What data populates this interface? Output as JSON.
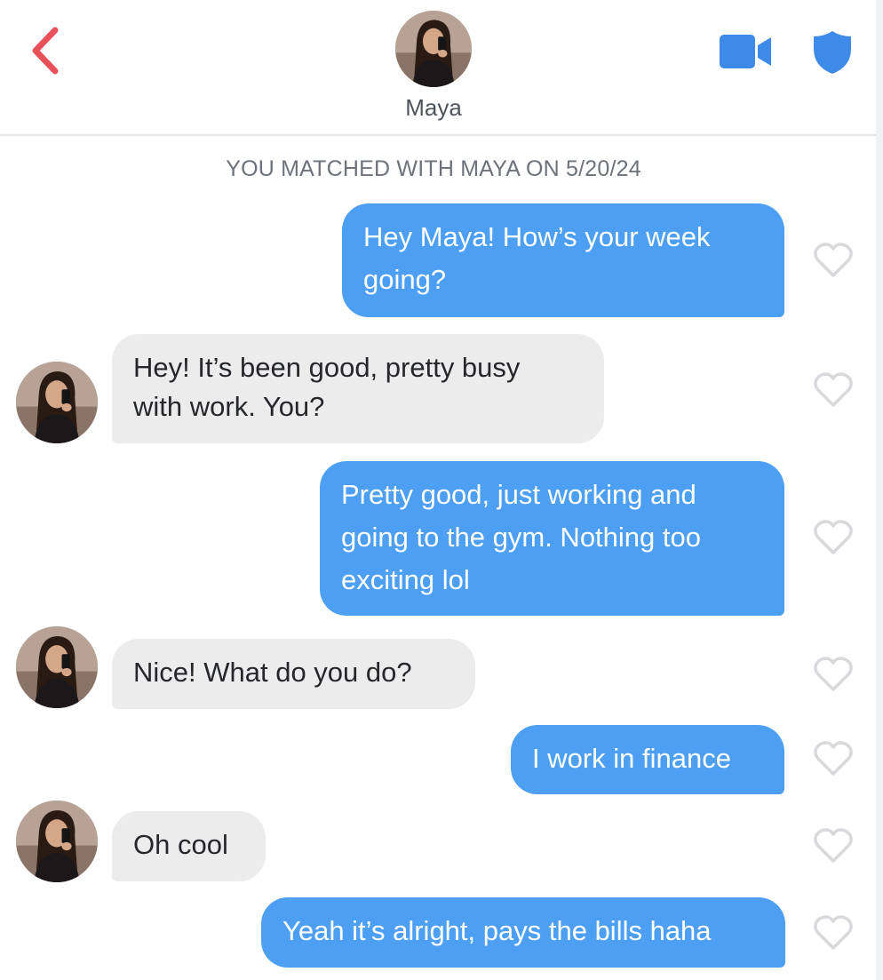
{
  "header": {
    "back_icon": "chevron-left-icon",
    "profile_name": "Maya",
    "video_icon": "video-camera-icon",
    "safety_icon": "shield-icon",
    "accent_color": "#e8505b",
    "icon_color": "#3e8ae8"
  },
  "conversation": {
    "match_note": "YOU MATCHED WITH MAYA ON 5/20/24",
    "messages": [
      {
        "sender": "me",
        "lines": [
          "Hey Maya! How’s your week",
          "going?"
        ]
      },
      {
        "sender": "them",
        "lines": [
          "Hey! It’s been good, pretty busy",
          "with work. You?"
        ]
      },
      {
        "sender": "me",
        "lines": [
          "Pretty good, just working and",
          "going to the gym. Nothing too",
          "exciting lol"
        ]
      },
      {
        "sender": "them",
        "lines": [
          "Nice! What do you do?"
        ]
      },
      {
        "sender": "me",
        "lines": [
          "I work in finance"
        ]
      },
      {
        "sender": "them",
        "lines": [
          "Oh cool"
        ]
      },
      {
        "sender": "me",
        "lines": [
          "Yeah it’s alright, pays the bills haha"
        ]
      }
    ],
    "heart_icon": "heart-outline-icon",
    "sent_bubble_color": "#4d9ff3",
    "received_bubble_color": "#ececed"
  }
}
